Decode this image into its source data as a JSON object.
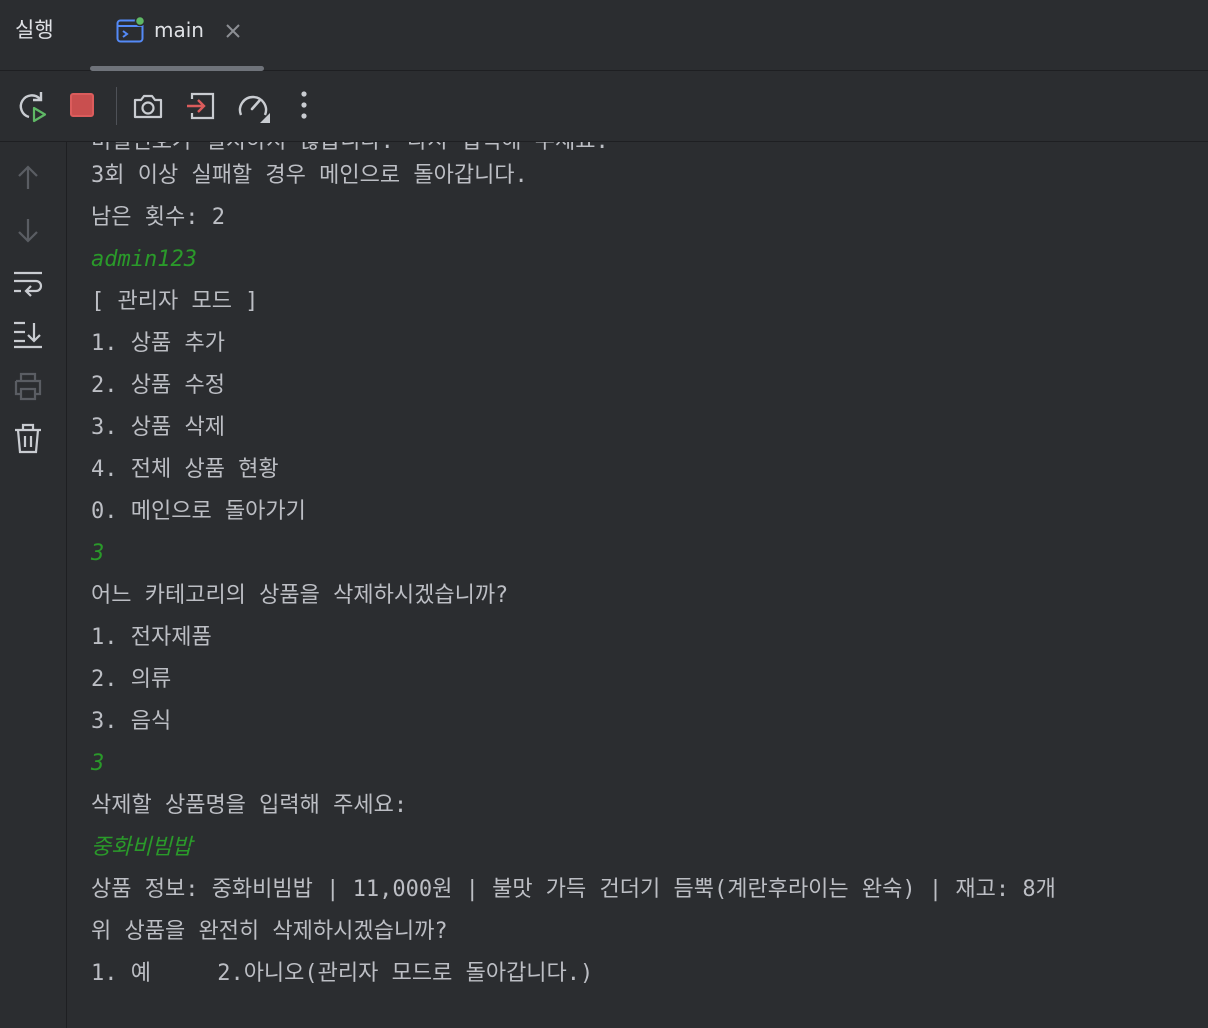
{
  "tool_window": {
    "title": "실행"
  },
  "tab": {
    "label": "main",
    "icon": "console-window-icon",
    "status_color": "#5fb865"
  },
  "toolbar": {
    "buttons": [
      {
        "name": "rerun-icon"
      },
      {
        "name": "stop-icon",
        "color": "#db5c5c"
      },
      {
        "name": "camera-icon"
      },
      {
        "name": "exit-icon"
      },
      {
        "name": "profiler-gauge-icon"
      },
      {
        "name": "more-options-icon"
      }
    ]
  },
  "gutter": {
    "buttons": [
      {
        "name": "up-arrow-icon"
      },
      {
        "name": "down-arrow-icon"
      },
      {
        "name": "soft-wrap-icon"
      },
      {
        "name": "scroll-to-end-icon"
      },
      {
        "name": "print-icon"
      },
      {
        "name": "trash-icon"
      }
    ]
  },
  "colors": {
    "output_text": "#bcbec4",
    "user_input_text": "#2a9a2a",
    "background": "#2b2d30"
  },
  "console": {
    "partial_top_line": "비밀번호가 일치하지 않습니다. 다시 입력해 주세요.",
    "lines": [
      {
        "text": "3회 이상 실패할 경우 메인으로 돌아갑니다.",
        "type": "output"
      },
      {
        "text": "남은 횟수: 2",
        "type": "output"
      },
      {
        "text": "admin123",
        "type": "input"
      },
      {
        "text": "[ 관리자 모드 ]",
        "type": "output"
      },
      {
        "text": "1. 상품 추가",
        "type": "output"
      },
      {
        "text": "2. 상품 수정",
        "type": "output"
      },
      {
        "text": "3. 상품 삭제",
        "type": "output"
      },
      {
        "text": "4. 전체 상품 현황",
        "type": "output"
      },
      {
        "text": "0. 메인으로 돌아가기",
        "type": "output"
      },
      {
        "text": "3",
        "type": "input"
      },
      {
        "text": "어느 카테고리의 상품을 삭제하시겠습니까?",
        "type": "output"
      },
      {
        "text": "1. 전자제품",
        "type": "output"
      },
      {
        "text": "2. 의류",
        "type": "output"
      },
      {
        "text": "3. 음식",
        "type": "output"
      },
      {
        "text": "3",
        "type": "input"
      },
      {
        "text": "삭제할 상품명을 입력해 주세요:",
        "type": "output"
      },
      {
        "text": "중화비빔밥",
        "type": "input"
      },
      {
        "text": "상품 정보: 중화비빔밥 | 11,000원 | 불맛 가득 건더기 듬뿍(계란후라이는 완숙) | 재고: 8개",
        "type": "output"
      },
      {
        "text": "위 상품을 완전히 삭제하시겠습니까?",
        "type": "output"
      },
      {
        "text": "1. 예     2.아니오(관리자 모드로 돌아갑니다.)",
        "type": "output"
      }
    ]
  }
}
